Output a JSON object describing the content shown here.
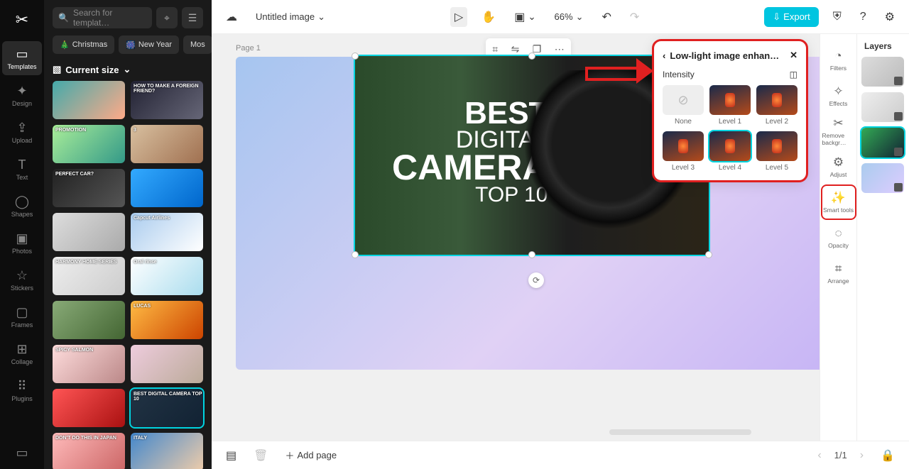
{
  "app": {
    "title": "Untitled image"
  },
  "nav": {
    "items": [
      {
        "label": "Templates",
        "icon": "▭"
      },
      {
        "label": "Design",
        "icon": "✦"
      },
      {
        "label": "Upload",
        "icon": "⇪"
      },
      {
        "label": "Text",
        "icon": "T"
      },
      {
        "label": "Shapes",
        "icon": "◯"
      },
      {
        "label": "Photos",
        "icon": "▣"
      },
      {
        "label": "Stickers",
        "icon": "☆"
      },
      {
        "label": "Frames",
        "icon": "▢"
      },
      {
        "label": "Collage",
        "icon": "⊞"
      },
      {
        "label": "Plugins",
        "icon": "⠿"
      }
    ]
  },
  "templates": {
    "search_placeholder": "Search for templat…",
    "tags": [
      {
        "icon": "🎄",
        "label": "Christmas"
      },
      {
        "icon": "🎆",
        "label": "New Year"
      },
      {
        "icon": "",
        "label": "Mos"
      }
    ],
    "size_label": "Current size",
    "items": [
      {
        "txt": ""
      },
      {
        "txt": "HOW TO MAKE A FOREIGN FRIEND?"
      },
      {
        "txt": "PROMOTION"
      },
      {
        "txt": "3"
      },
      {
        "txt": "PERFECT CAR?"
      },
      {
        "txt": ""
      },
      {
        "txt": ""
      },
      {
        "txt": "Capcut Airlines"
      },
      {
        "txt": "HARMONY HOME SERIES"
      },
      {
        "txt": "Oral rinse"
      },
      {
        "txt": ""
      },
      {
        "txt": "LUCAS"
      },
      {
        "txt": "SPICY SALMON"
      },
      {
        "txt": ""
      },
      {
        "txt": ""
      },
      {
        "txt": "BEST DIGITAL CAMERA TOP 10",
        "sel": true
      },
      {
        "txt": "DON'T DO THIS IN JAPAN"
      },
      {
        "txt": "ITALY"
      }
    ]
  },
  "topbar": {
    "zoom": "66%",
    "export": "Export"
  },
  "canvas": {
    "page_label": "Page 1",
    "image_text": {
      "l1": "BEST",
      "l2": "DIGITAL",
      "l3": "CAMERA",
      "l4": "TOP 10"
    }
  },
  "right_tools": [
    {
      "label": "Filters",
      "icon": "◔"
    },
    {
      "label": "Effects",
      "icon": "✧"
    },
    {
      "label": "Remove backgr…",
      "icon": "✂"
    },
    {
      "label": "Adjust",
      "icon": "⚙"
    },
    {
      "label": "Smart tools",
      "icon": "✨",
      "boxed": true
    },
    {
      "label": "Opacity",
      "icon": "◌"
    },
    {
      "label": "Arrange",
      "icon": "⌗"
    }
  ],
  "layers": {
    "title": "Layers",
    "items": [
      {
        "sel": false
      },
      {
        "sel": false
      },
      {
        "sel": true
      },
      {
        "sel": false
      }
    ]
  },
  "bottombar": {
    "add_page": "Add page",
    "page_counter": "1/1"
  },
  "popup": {
    "title": "Low-light image enhan…",
    "intensity_label": "Intensity",
    "levels": [
      {
        "label": "None",
        "none": true
      },
      {
        "label": "Level 1"
      },
      {
        "label": "Level 2"
      },
      {
        "label": "Level 3"
      },
      {
        "label": "Level 4",
        "sel": true
      },
      {
        "label": "Level 5"
      }
    ]
  }
}
